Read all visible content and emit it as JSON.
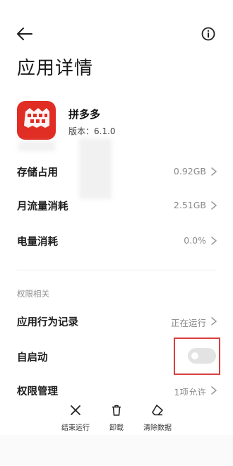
{
  "header": {
    "title": "应用详情"
  },
  "app": {
    "name": "拼多多",
    "version": "版本：6.1.0"
  },
  "rows": [
    {
      "label": "存储占用",
      "value": "0.92GB"
    },
    {
      "label": "月流量消耗",
      "value": "2.51GB"
    },
    {
      "label": "电量消耗",
      "value": "0.0%"
    }
  ],
  "section": {
    "title": "权限相关"
  },
  "permission_rows": [
    {
      "label": "应用行为记录",
      "value": "正在运行"
    },
    {
      "label": "自启动",
      "toggle_on": false
    },
    {
      "label": "权限管理",
      "value": "1项允许"
    }
  ],
  "actions": [
    {
      "label": "结束运行",
      "icon": "close-icon"
    },
    {
      "label": "卸载",
      "icon": "trash-icon"
    },
    {
      "label": "清除数据",
      "icon": "eraser-icon"
    }
  ],
  "colors": {
    "highlight": "#d94040",
    "app_icon": "#e02e24"
  }
}
